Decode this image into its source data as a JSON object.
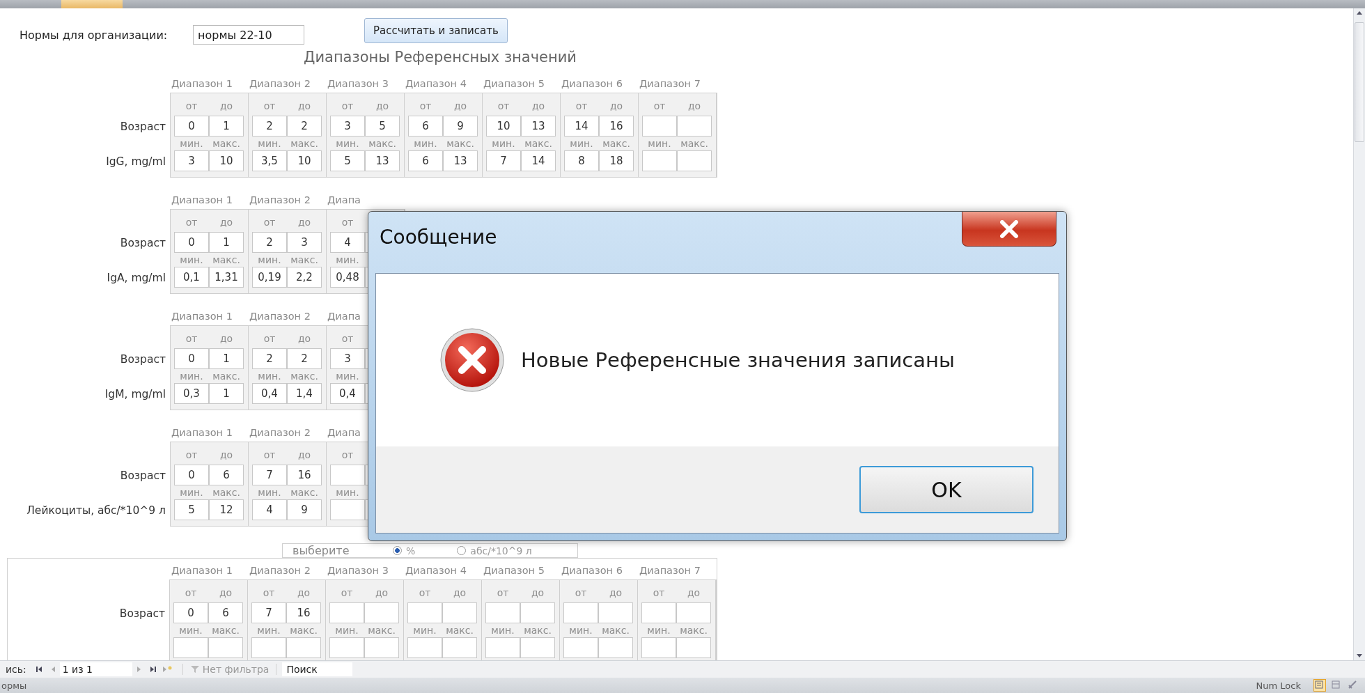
{
  "org": {
    "label": "Нормы для организации:",
    "value": "нормы 22-10"
  },
  "calc_button": "Рассчитать и записать",
  "title": "Диапазоны Референсных значений",
  "blocks": [
    {
      "age_label": "Возраст",
      "analyte": "IgG, mg/ml",
      "ranges": [
        {
          "header": "Диапазон 1",
          "l_from": "от",
          "l_to": "до",
          "l_min": "мин.",
          "l_max": "макс.",
          "from": "0",
          "to": "1",
          "min": "3",
          "max": "10"
        },
        {
          "header": "Диапазон 2",
          "l_from": "от",
          "l_to": "до",
          "l_min": "мин.",
          "l_max": "макс.",
          "from": "2",
          "to": "2",
          "min": "3,5",
          "max": "10"
        },
        {
          "header": "Диапазон 3",
          "l_from": "от",
          "l_to": "до",
          "l_min": "мин.",
          "l_max": "макс.",
          "from": "3",
          "to": "5",
          "min": "5",
          "max": "13"
        },
        {
          "header": "Диапазон 4",
          "l_from": "от",
          "l_to": "до",
          "l_min": "мин.",
          "l_max": "макс.",
          "from": "6",
          "to": "9",
          "min": "6",
          "max": "13"
        },
        {
          "header": "Диапазон 5",
          "l_from": "от",
          "l_to": "до",
          "l_min": "мин.",
          "l_max": "макс.",
          "from": "10",
          "to": "13",
          "min": "7",
          "max": "14"
        },
        {
          "header": "Диапазон 6",
          "l_from": "от",
          "l_to": "до",
          "l_min": "мин.",
          "l_max": "макс.",
          "from": "14",
          "to": "16",
          "min": "8",
          "max": "18"
        },
        {
          "header": "Диапазон 7",
          "l_from": "от",
          "l_to": "до",
          "l_min": "мин.",
          "l_max": "макс."
        }
      ]
    },
    {
      "age_label": "Возраст",
      "analyte": "IgA, mg/ml",
      "ranges": [
        {
          "header": "Диапазон 1",
          "l_from": "от",
          "l_to": "до",
          "l_min": "мин.",
          "l_max": "макс.",
          "from": "0",
          "to": "1",
          "min": "0,1",
          "max": "1,31"
        },
        {
          "header": "Диапазон 2",
          "l_from": "от",
          "l_to": "до",
          "l_min": "мин.",
          "l_max": "макс.",
          "from": "2",
          "to": "3",
          "min": "0,19",
          "max": "2,2"
        },
        {
          "header": "Диапа",
          "l_from": "от",
          "l_min": "мин.",
          "from": "4",
          "min": "0,48"
        }
      ]
    },
    {
      "age_label": "Возраст",
      "analyte": "IgM, mg/ml",
      "ranges": [
        {
          "header": "Диапазон 1",
          "l_from": "от",
          "l_to": "до",
          "l_min": "мин.",
          "l_max": "макс.",
          "from": "0",
          "to": "1",
          "min": "0,3",
          "max": "1"
        },
        {
          "header": "Диапазон 2",
          "l_from": "от",
          "l_to": "до",
          "l_min": "мин.",
          "l_max": "макс.",
          "from": "2",
          "to": "2",
          "min": "0,4",
          "max": "1,4"
        },
        {
          "header": "Диапа",
          "l_from": "от",
          "l_min": "мин.",
          "from": "3",
          "min": "0,4"
        }
      ]
    },
    {
      "age_label": "Возраст",
      "analyte": "Лейкоциты, абс/*10^9 л",
      "ranges": [
        {
          "header": "Диапазон 1",
          "l_from": "от",
          "l_to": "до",
          "l_min": "мин.",
          "l_max": "макс.",
          "from": "0",
          "to": "6",
          "min": "5",
          "max": "12"
        },
        {
          "header": "Диапазон 2",
          "l_from": "от",
          "l_to": "до",
          "l_min": "мин.",
          "l_max": "макс.",
          "from": "7",
          "to": "16",
          "min": "4",
          "max": "9"
        },
        {
          "header": "Диапа",
          "l_from": "от",
          "l_min": "мин."
        }
      ]
    }
  ],
  "unit_choice": {
    "label": "выберите",
    "options": [
      {
        "label": "%",
        "selected": true
      },
      {
        "label": "абс/*10^9 л",
        "selected": false
      }
    ]
  },
  "last_block": {
    "age_label": "Возраст",
    "ranges": [
      {
        "header": "Диапазон 1",
        "l_from": "от",
        "l_to": "до",
        "l_min": "мин.",
        "l_max": "макс.",
        "from": "0",
        "to": "6"
      },
      {
        "header": "Диапазон 2",
        "l_from": "от",
        "l_to": "до",
        "l_min": "мин.",
        "l_max": "макс.",
        "from": "7",
        "to": "16"
      },
      {
        "header": "Диапазон 3",
        "l_from": "от",
        "l_to": "до",
        "l_min": "мин.",
        "l_max": "макс."
      },
      {
        "header": "Диапазон 4",
        "l_from": "от",
        "l_to": "до",
        "l_min": "мин.",
        "l_max": "макс."
      },
      {
        "header": "Диапазон 5",
        "l_from": "от",
        "l_to": "до",
        "l_min": "мин.",
        "l_max": "макс."
      },
      {
        "header": "Диапазон 6",
        "l_from": "от",
        "l_to": "до",
        "l_min": "мин.",
        "l_max": "макс."
      },
      {
        "header": "Диапазон 7",
        "l_from": "от",
        "l_to": "до",
        "l_min": "мин.",
        "l_max": "макс."
      }
    ]
  },
  "record_nav": {
    "label": "ись:",
    "position": "1 из 1",
    "filter": "Нет фильтра",
    "search": "Поиск"
  },
  "status_bar": {
    "text": "ормы",
    "num_lock": "Num Lock"
  },
  "dialog": {
    "title": "Сообщение",
    "message": "Новые Референсные значения записаны",
    "ok": "OK"
  }
}
